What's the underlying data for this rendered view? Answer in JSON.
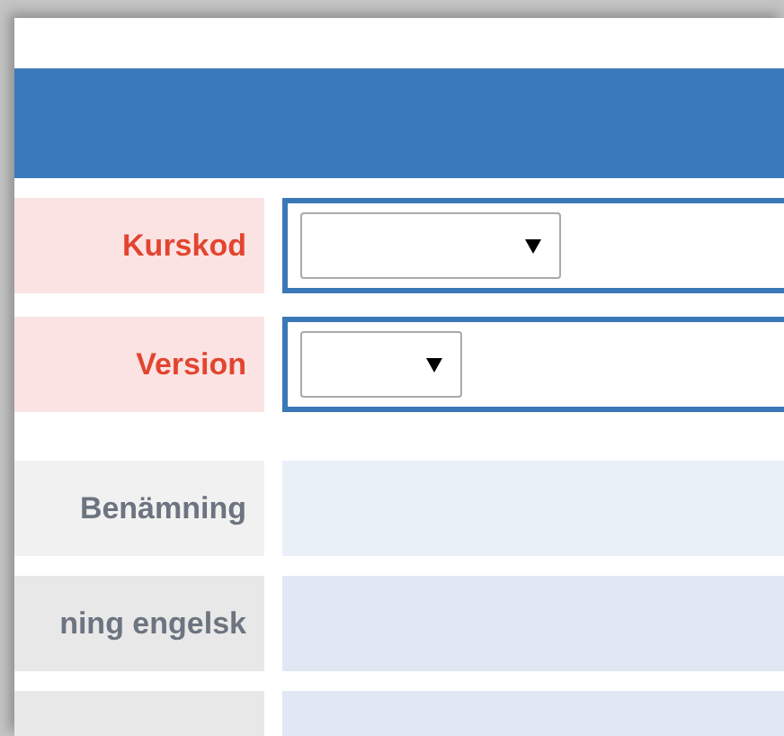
{
  "header_bar": {
    "kind": "bar"
  },
  "required_fields": [
    {
      "label": "Kurskod"
    },
    {
      "label": "Version"
    }
  ],
  "info_fields": [
    {
      "kind": "readonly",
      "label": "Benämning"
    },
    {
      "kind": "readonly",
      "label": "ning engelsk"
    },
    {
      "kind": "readonly"
    }
  ]
}
